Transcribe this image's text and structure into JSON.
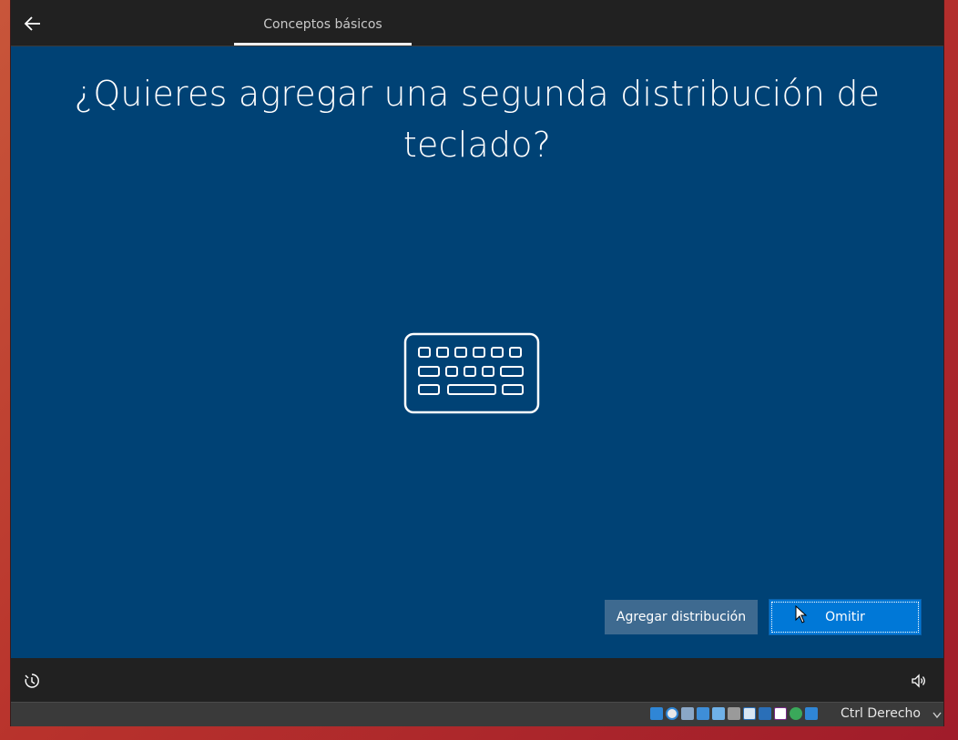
{
  "topbar": {
    "back_icon": "arrow-left-icon",
    "tab_label": "Conceptos básicos"
  },
  "main": {
    "title": "¿Quieres agregar una segunda distribución de teclado?",
    "illustration_icon": "keyboard-icon",
    "add_button_label": "Agregar distribución",
    "skip_button_label": "Omitir"
  },
  "bottombar": {
    "ease_of_access_icon": "ease-of-access-icon",
    "volume_icon": "volume-icon"
  },
  "statusbar": {
    "host_key": "Ctrl Derecho",
    "icons": [
      "hard-disk-icon",
      "optical-drive-icon",
      "audio-icon",
      "network-icon",
      "usb-icon",
      "shared-folder-icon",
      "display-icon",
      "capture-icon",
      "cpu-icon",
      "mouse-integration-icon",
      "keyboard-capture-icon"
    ]
  },
  "colors": {
    "content_bg": "#004275",
    "topbar_bg": "#212121",
    "primary_button": "#0078d7",
    "secondary_button": "#3e6a90"
  }
}
